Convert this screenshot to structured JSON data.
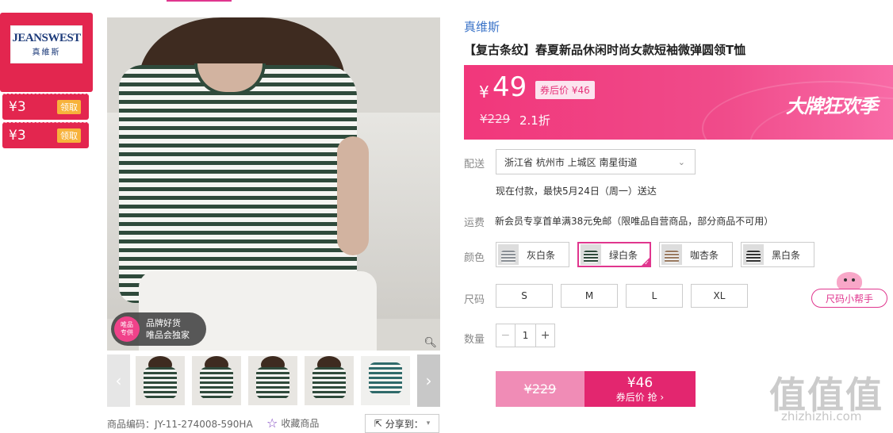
{
  "brand": {
    "logo_text": "JEANSWEST",
    "logo_sub": "真維斯"
  },
  "coupons": [
    {
      "value": "¥3",
      "action": "领取"
    },
    {
      "value": "¥3",
      "action": "领取"
    }
  ],
  "badge": {
    "circle": [
      "唯品",
      "专供"
    ],
    "line1": "品牌好货",
    "line2": "唯品会独家"
  },
  "product": {
    "brand_name": "真维斯",
    "title": "【复古条纹】春夏新品休闲时尚女款短袖微弹圆领T恤",
    "code": "商品编码：JY-11-274008-590HA",
    "favorite": "收藏商品",
    "share": "分享到："
  },
  "price": {
    "currency": "¥",
    "current": "49",
    "after_coupon": "券后价 ¥46",
    "original": "¥229",
    "discount": "2.1折",
    "event": "大牌狂欢季"
  },
  "delivery": {
    "label": "配送",
    "address": "浙江省 杭州市 上城区 南星街道",
    "note": "现在付款，最快5月24日（周一）送达"
  },
  "shipping": {
    "label": "运费",
    "text": "新会员专享首单满38元免邮（限唯品自营商品，部分商品不可用）"
  },
  "colors": {
    "label": "颜色",
    "options": [
      "灰白条",
      "绿白条",
      "咖杏条",
      "黑白条"
    ],
    "selected": 1,
    "swatch_colors": [
      "#8a8f95",
      "#2f4a3b",
      "#9a7a60",
      "#333333"
    ]
  },
  "sizes": {
    "label": "尺码",
    "options": [
      "S",
      "M",
      "L",
      "XL"
    ],
    "helper": "尺码小帮手"
  },
  "quantity": {
    "label": "数量",
    "value": "1",
    "minus": "−",
    "plus": "+"
  },
  "buy": {
    "original": "¥229",
    "price": "¥46",
    "action": "券后价 抢 ›"
  },
  "watermark": {
    "text": "值值值",
    "url": "zhizhizhi.com"
  },
  "icons": {
    "zoom": "search-icon",
    "prev": "chevron-left-icon",
    "next": "chevron-right-icon",
    "star": "star-icon",
    "share": "share-icon",
    "dropdown": "chevron-down-icon"
  },
  "colors_theme": {
    "accent": "#e0368e",
    "brand_red": "#e3264f",
    "link_blue": "#3a73c8"
  }
}
